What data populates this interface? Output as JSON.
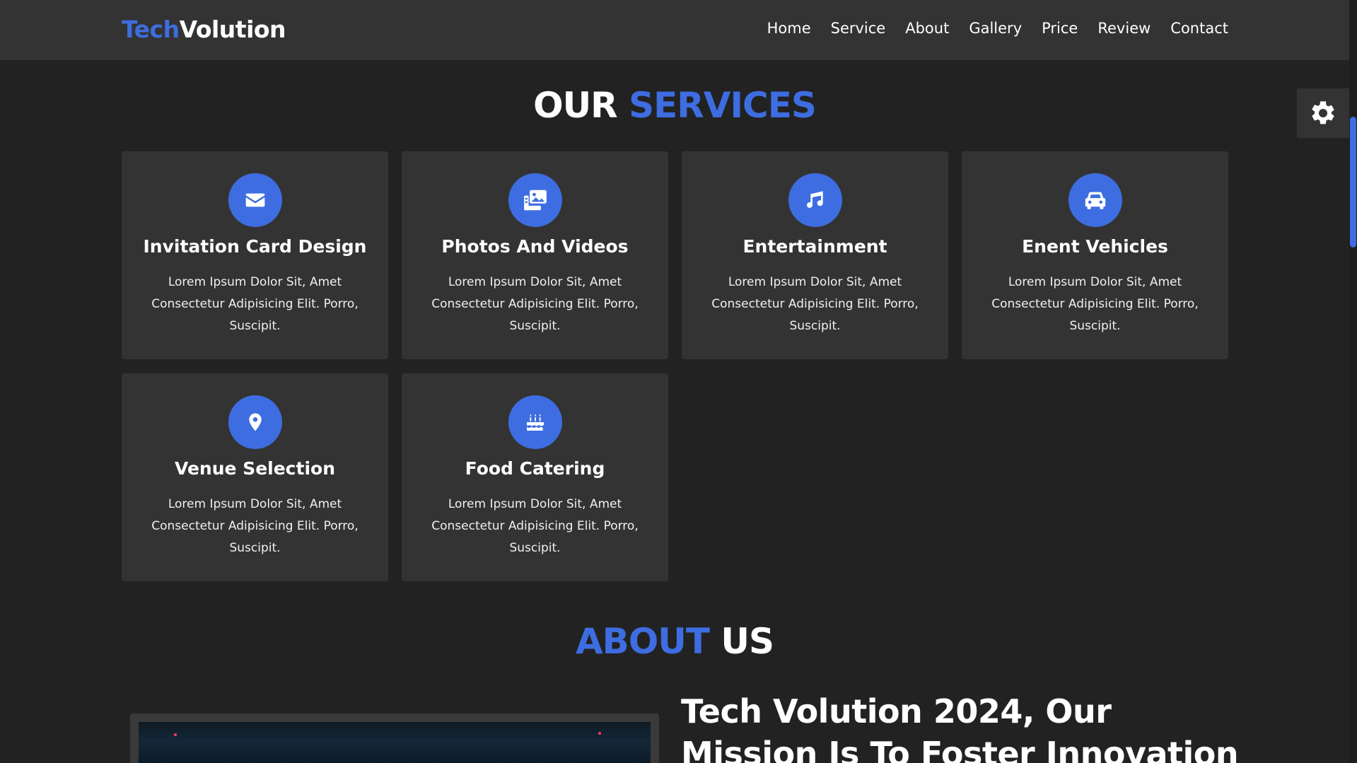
{
  "header": {
    "logo_accent": "Tech",
    "logo_main": "Volution",
    "nav": [
      "Home",
      "Service",
      "About",
      "Gallery",
      "Price",
      "Review",
      "Contact"
    ]
  },
  "services": {
    "title_part1": "OUR",
    "title_part2": "SERVICES",
    "cards": [
      {
        "icon": "envelope-icon",
        "title": "Invitation Card Design",
        "text": "Lorem Ipsum Dolor Sit, Amet Consectetur Adipisicing Elit. Porro, Suscipit."
      },
      {
        "icon": "photos-icon",
        "title": "Photos And Videos",
        "text": "Lorem Ipsum Dolor Sit, Amet Consectetur Adipisicing Elit. Porro, Suscipit."
      },
      {
        "icon": "music-icon",
        "title": "Entertainment",
        "text": "Lorem Ipsum Dolor Sit, Amet Consectetur Adipisicing Elit. Porro, Suscipit."
      },
      {
        "icon": "car-icon",
        "title": "Enent Vehicles",
        "text": "Lorem Ipsum Dolor Sit, Amet Consectetur Adipisicing Elit. Porro, Suscipit."
      },
      {
        "icon": "map-marker-icon",
        "title": "Venue Selection",
        "text": "Lorem Ipsum Dolor Sit, Amet Consectetur Adipisicing Elit. Porro, Suscipit."
      },
      {
        "icon": "birthday-cake-icon",
        "title": "Food Catering",
        "text": "Lorem Ipsum Dolor Sit, Amet Consectetur Adipisicing Elit. Porro, Suscipit."
      }
    ]
  },
  "about": {
    "title_part1": "ABOUT",
    "title_part2": "US",
    "heading": "Tech Volution 2024, Our Mission Is To Foster Innovation"
  },
  "colors": {
    "accent": "#3d6de0",
    "background": "#222222",
    "surface": "#333333"
  }
}
